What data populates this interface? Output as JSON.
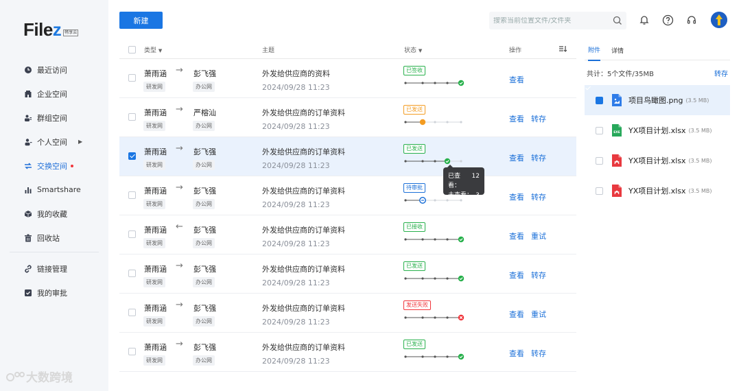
{
  "app": {
    "logo_prefix": "File",
    "logo_z": "z",
    "logo_badge": "畅享云"
  },
  "sidebar": {
    "items": [
      {
        "label": "最近访问",
        "icon": "clock-icon"
      },
      {
        "label": "企业空间",
        "icon": "building-icon"
      },
      {
        "label": "群组空间",
        "icon": "group-icon"
      },
      {
        "label": "个人空间",
        "icon": "person-icon"
      },
      {
        "label": "交换空间",
        "icon": "exchange-icon"
      },
      {
        "label": "Smartshare",
        "icon": "bar-chart-icon"
      },
      {
        "label": "我的收藏",
        "icon": "cube-icon"
      },
      {
        "label": "回收站",
        "icon": "trash-icon"
      },
      {
        "label": "链接管理",
        "icon": "link-icon"
      },
      {
        "label": "我的审批",
        "icon": "approval-icon"
      }
    ],
    "active_index": 4
  },
  "watermark": "大数跨境",
  "toolbar": {
    "new_label": "新建",
    "search_placeholder": "搜索当前位置文件/文件夹"
  },
  "table": {
    "headers": {
      "type": "类型",
      "subject": "主题",
      "status": "状态",
      "action": "操作"
    },
    "rows": [
      {
        "from": "萧雨涵",
        "to": "彭飞强",
        "from_tag": "研发网",
        "to_tag": "办公网",
        "direction": "→",
        "subject": "外发给供应商的资料",
        "date": "2024/09/28 11:23",
        "status": "已签收",
        "status_color": "#27b04b",
        "stage": 4,
        "end_state": "check",
        "actions": [
          "查看"
        ],
        "checked": false
      },
      {
        "from": "萧雨涵",
        "to": "严榕汕",
        "from_tag": "研发网",
        "to_tag": "办公网",
        "direction": "→",
        "subject": "外发给供应商的订单资料",
        "date": "2024/09/28 11:23",
        "status": "已发送",
        "status_color": "#f39c22",
        "stage": 1,
        "end_state": "pending",
        "actions": [
          "查看",
          "转存"
        ],
        "checked": false
      },
      {
        "from": "萧雨涵",
        "to": "彭飞强",
        "from_tag": "研发网",
        "to_tag": "办公网",
        "direction": "→",
        "subject": "外发给供应商的订单资料",
        "date": "2024/09/28 11:23",
        "status": "已发送",
        "status_color": "#27b04b",
        "stage": 3,
        "end_state": "check",
        "actions": [
          "查看",
          "转存"
        ],
        "checked": true
      },
      {
        "from": "萧雨涵",
        "to": "彭飞强",
        "from_tag": "研发网",
        "to_tag": "办公网",
        "direction": "→",
        "subject": "外发给供应商的订单资料",
        "date": "2024/09/28 11:23",
        "status": "待审批",
        "status_color": "#1a6fd8",
        "stage": 1,
        "end_state": "waiting",
        "actions": [
          "查看",
          "转存"
        ],
        "checked": false
      },
      {
        "from": "萧雨涵",
        "to": "彭飞强",
        "from_tag": "研发网",
        "to_tag": "办公网",
        "direction": "←",
        "subject": "外发给供应商的订单资料",
        "date": "2024/09/28 11:23",
        "status": "已接收",
        "status_color": "#27b04b",
        "stage": 4,
        "end_state": "check",
        "actions": [
          "查看",
          "重试"
        ],
        "checked": false
      },
      {
        "from": "萧雨涵",
        "to": "彭飞强",
        "from_tag": "研发网",
        "to_tag": "办公网",
        "direction": "→",
        "subject": "外发给供应商的订单资料",
        "date": "2024/09/28 11:23",
        "status": "已发送",
        "status_color": "#27b04b",
        "stage": 4,
        "end_state": "check",
        "actions": [
          "查看",
          "转存"
        ],
        "checked": false
      },
      {
        "from": "萧雨涵",
        "to": "彭飞强",
        "from_tag": "研发网",
        "to_tag": "办公网",
        "direction": "→",
        "subject": "外发给供应商的订单资料",
        "date": "2024/09/28 11:23",
        "status": "发送失败",
        "status_color": "#f0343a",
        "stage": 4,
        "end_state": "fail",
        "actions": [
          "查看",
          "重试"
        ],
        "checked": false
      },
      {
        "from": "萧雨涵",
        "to": "彭飞强",
        "from_tag": "研发网",
        "to_tag": "办公网",
        "direction": "→",
        "subject": "外发给供应商的订单资料",
        "date": "2024/09/28 11:23",
        "status": "已发送",
        "status_color": "#27b04b",
        "stage": 4,
        "end_state": "check",
        "actions": [
          "查看",
          "转存"
        ],
        "checked": false
      }
    ]
  },
  "tooltip": {
    "viewed_label": "已查看：",
    "viewed_count": "12",
    "unviewed_label": "未查看：",
    "unviewed_count": "3"
  },
  "panel": {
    "tabs": [
      "附件",
      "详情"
    ],
    "summary": "共计：5个文件/35MB",
    "transfer_label": "转存",
    "files": [
      {
        "name": "项目鸟瞰图.png",
        "size": "(3.5 MB)",
        "type": "image",
        "color": "#2f7ce8",
        "checked": true
      },
      {
        "name": "YX项目计划.xlsx",
        "size": "(3.5 MB)",
        "type": "exe",
        "color": "#27a85a",
        "checked": false
      },
      {
        "name": "YX项目计划.xlsx",
        "size": "(3.5 MB)",
        "type": "pdf",
        "color": "#e8393f",
        "checked": false
      },
      {
        "name": "YX项目计划.xlsx",
        "size": "(3.5 MB)",
        "type": "pdf",
        "color": "#e8393f",
        "checked": false
      }
    ]
  }
}
